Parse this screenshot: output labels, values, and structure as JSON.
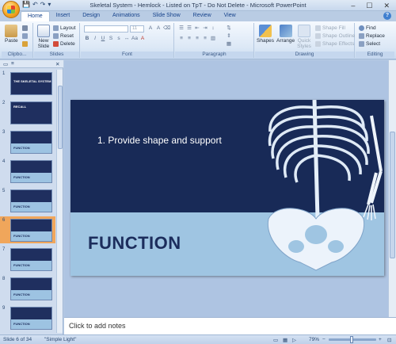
{
  "window": {
    "title": "Skeletal System - Hemlock - Listed on TpT - Do Not Delete - Microsoft PowerPoint",
    "minimize": "–",
    "maximize": "☐",
    "close": "✕"
  },
  "qat": {
    "save": "💾",
    "undo": "↶",
    "redo": "↷",
    "more": "▾"
  },
  "tabs": [
    {
      "label": "Home",
      "active": true
    },
    {
      "label": "Insert"
    },
    {
      "label": "Design"
    },
    {
      "label": "Animations"
    },
    {
      "label": "Slide Show"
    },
    {
      "label": "Review"
    },
    {
      "label": "View"
    }
  ],
  "ribbon": {
    "clipboard": {
      "label": "Clipbo...",
      "paste": "Paste"
    },
    "slides": {
      "label": "Slides",
      "new_slide": "New Slide",
      "layout": "Layout",
      "reset": "Reset",
      "delete": "Delete"
    },
    "font": {
      "label": "Font",
      "size": "11"
    },
    "paragraph": {
      "label": "Paragraph"
    },
    "drawing": {
      "label": "Drawing",
      "shapes": "Shapes",
      "arrange": "Arrange",
      "quick_styles": "Quick Styles",
      "shape_fill": "Shape Fill",
      "shape_outline": "Shape Outline",
      "shape_effects": "Shape Effects"
    },
    "editing": {
      "label": "Editing",
      "find": "Find",
      "replace": "Replace",
      "select": "Select"
    }
  },
  "left_panel": {
    "slides": [
      {
        "num": "1",
        "label": "THE SKELETAL SYSTEM"
      },
      {
        "num": "2",
        "label": "RECALL"
      },
      {
        "num": "3",
        "label": "FUNCTION"
      },
      {
        "num": "4",
        "label": "FUNCTION"
      },
      {
        "num": "5",
        "label": "FUNCTION"
      },
      {
        "num": "6",
        "label": "FUNCTION"
      },
      {
        "num": "7",
        "label": "FUNCTION"
      },
      {
        "num": "8",
        "label": "FUNCTION"
      },
      {
        "num": "9",
        "label": "FUNCTION"
      }
    ],
    "selected_index": 5
  },
  "slide": {
    "bullet": "1.  Provide shape and support",
    "heading": "FUNCTION"
  },
  "notes": {
    "placeholder": "Click to add notes"
  },
  "status": {
    "slide_info": "Slide 6 of 34",
    "theme": "\"Simple Light\"",
    "zoom": "79%"
  }
}
